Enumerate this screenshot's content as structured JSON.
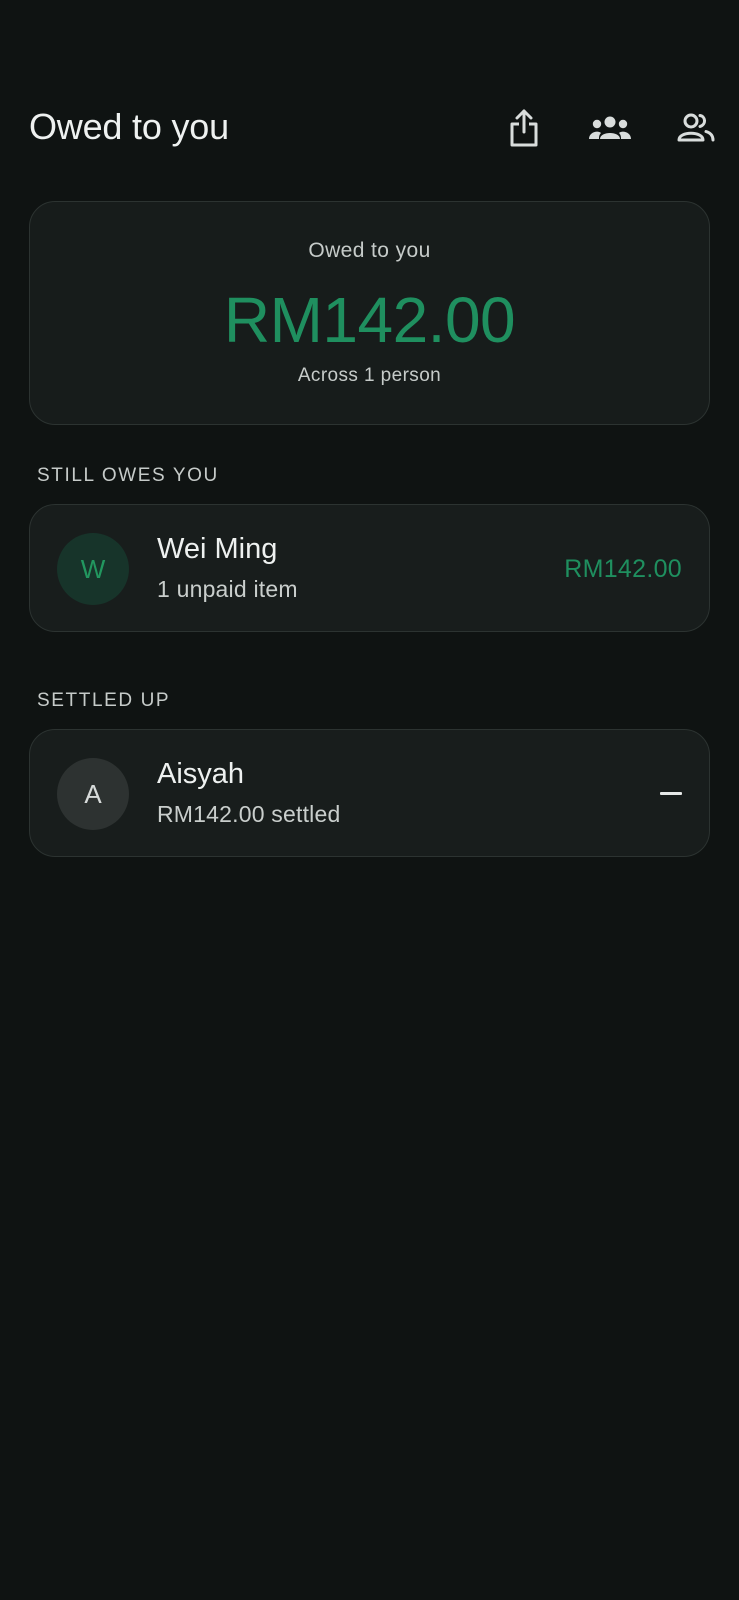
{
  "header": {
    "title": "Owed to you",
    "icons": [
      "share-icon",
      "group-icon",
      "people-icon"
    ]
  },
  "summary": {
    "label": "Owed to you",
    "amount": "RM142.00",
    "subtitle": "Across 1 person"
  },
  "sections": {
    "owes_label": "STILL OWES YOU",
    "settled_label": "SETTLED UP"
  },
  "owes": [
    {
      "initial": "W",
      "name": "Wei Ming",
      "detail": "1 unpaid item",
      "amount": "RM142.00"
    }
  ],
  "settled": [
    {
      "initial": "A",
      "name": "Aisyah",
      "detail": "RM142.00 settled",
      "trailing": "dash-icon"
    }
  ],
  "colors": {
    "background": "#0f1312",
    "card": "#171c1b",
    "accent_green": "#1f8f5f",
    "text_primary": "#eef1f0",
    "text_secondary": "#c6cbc9"
  }
}
